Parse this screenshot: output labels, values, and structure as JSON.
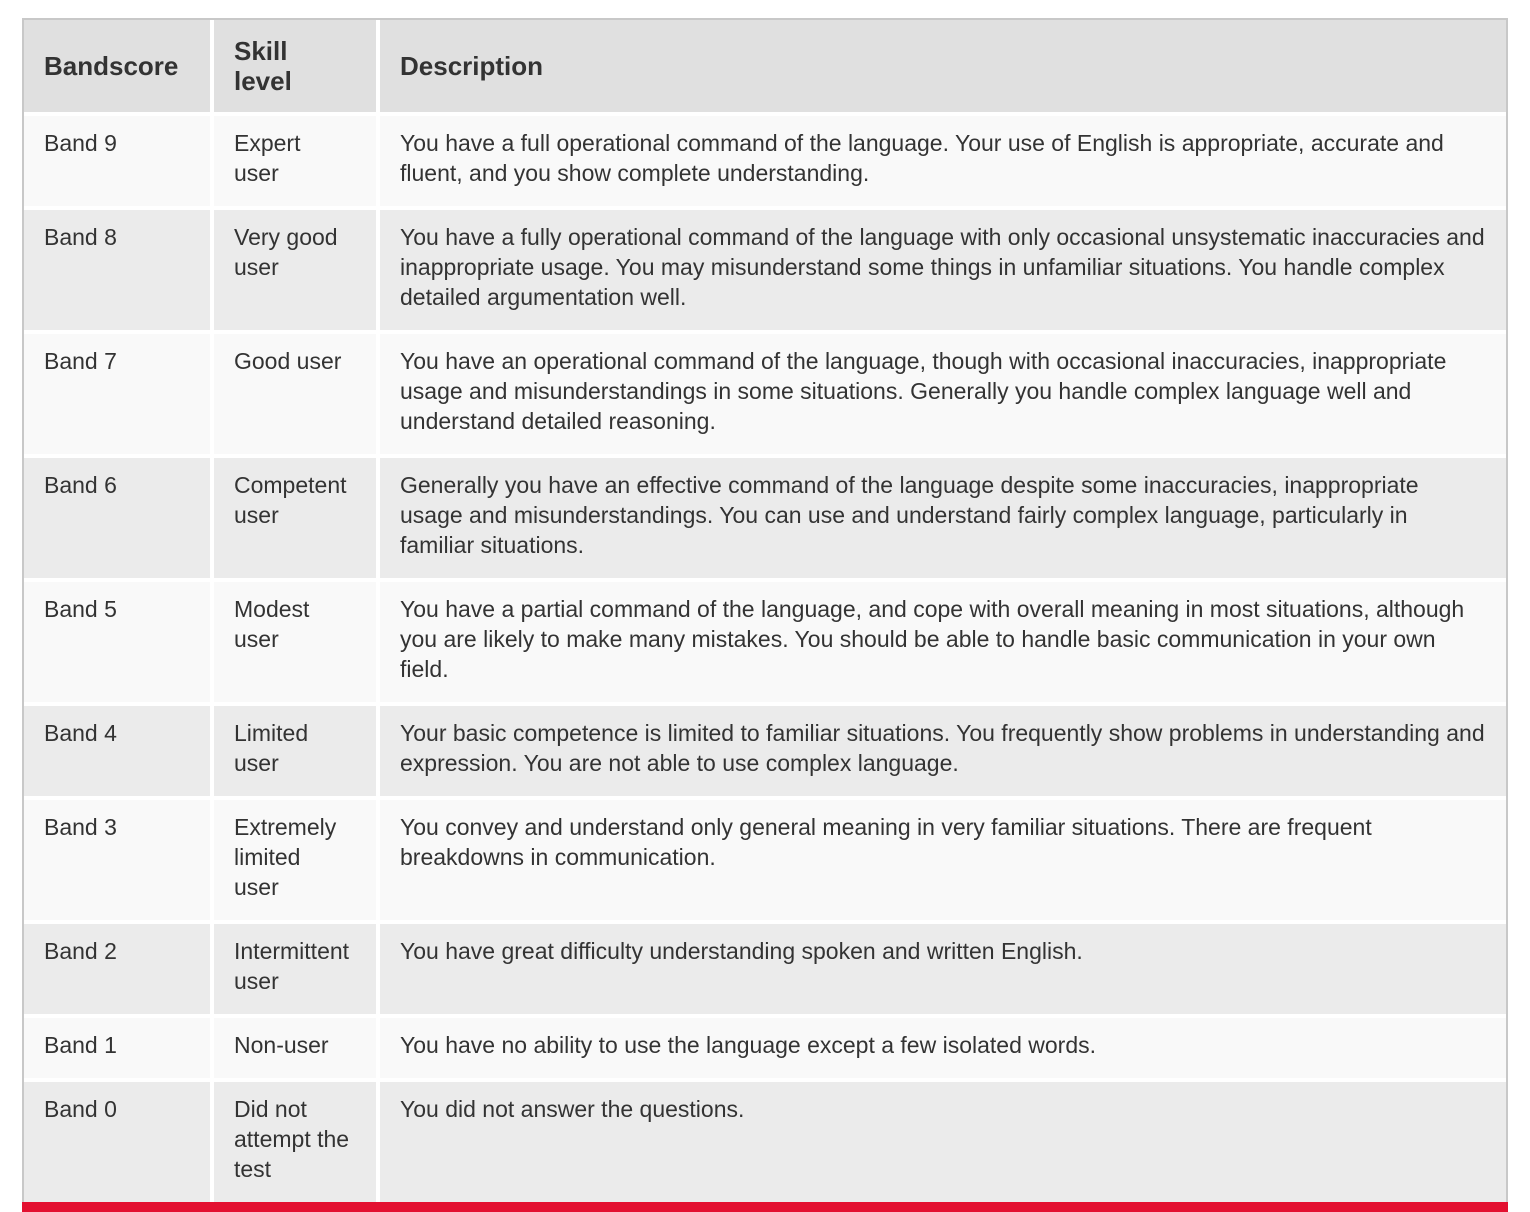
{
  "table": {
    "headers": [
      "Bandscore",
      "Skill level",
      "Description"
    ],
    "rows": [
      {
        "band": "Band 9",
        "skill": "Expert user",
        "description": "You have a full operational command of the language. Your use of English is appropriate, accurate and fluent, and you show complete understanding."
      },
      {
        "band": "Band 8",
        "skill": "Very good user",
        "description": "You have a fully operational command of the language with only occasional unsystematic inaccuracies and inappropriate usage. You may misunderstand some things in unfamiliar situations. You handle complex detailed argumentation well."
      },
      {
        "band": "Band 7",
        "skill": "Good user",
        "description": "You have an operational command of the language, though with occasional inaccuracies, inappropriate usage and misunderstandings in some situations. Generally you handle complex language well and understand detailed reasoning."
      },
      {
        "band": "Band 6",
        "skill": "Competent user",
        "description": "Generally you have an effective command of the language despite some inaccuracies, inappropriate usage and misunderstandings. You can use and understand fairly complex language, particularly in familiar situations."
      },
      {
        "band": "Band 5",
        "skill": "Modest user",
        "description": "You have a partial command of the language, and cope with overall meaning in most situations, although you are likely to make many mistakes. You should be able to handle basic communication in your own field."
      },
      {
        "band": "Band 4",
        "skill": "Limited user",
        "description": "Your basic competence is limited to familiar situations. You frequently show problems in understanding and expression. You are not able to use complex language."
      },
      {
        "band": "Band 3",
        "skill": "Extremely limited user",
        "description": "You convey and understand only general meaning in very familiar situations. There are frequent breakdowns in communication."
      },
      {
        "band": "Band 2",
        "skill": "Intermittent user",
        "description": "You have great difficulty understanding spoken and written English."
      },
      {
        "band": "Band 1",
        "skill": "Non-user",
        "description": "You have no ability to use the language except a few isolated words."
      },
      {
        "band": "Band 0",
        "skill": "Did not attempt the test",
        "description": "You did not answer the questions."
      }
    ]
  },
  "colors": {
    "header_bg": "#e0e0e0",
    "row_light": "#f9f9f9",
    "row_dark": "#ebebeb",
    "accent_bar": "#e31030",
    "text": "#333333"
  }
}
